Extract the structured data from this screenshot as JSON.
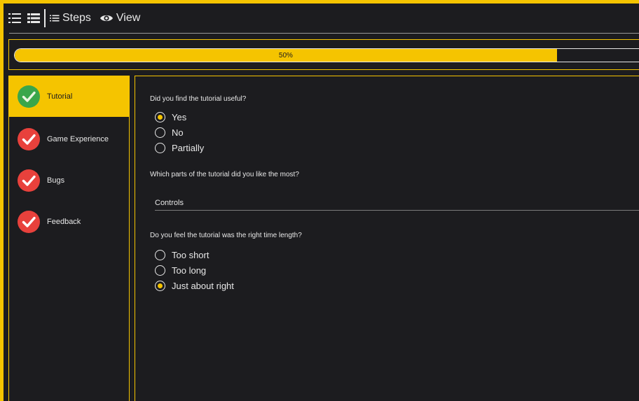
{
  "toolbar": {
    "steps_label": "Steps",
    "view_label": "View"
  },
  "progress": {
    "label": "50%",
    "value": 0.5
  },
  "sidebar": {
    "steps": [
      {
        "label": "Tutorial",
        "status": "complete",
        "active": true
      },
      {
        "label": "Game Experience",
        "status": "incomplete",
        "active": false
      },
      {
        "label": "Bugs",
        "status": "incomplete",
        "active": false
      },
      {
        "label": "Feedback",
        "status": "incomplete",
        "active": false
      }
    ]
  },
  "form": {
    "q1": {
      "text": "Did you find the tutorial useful?",
      "options": [
        "Yes",
        "No",
        "Partially"
      ],
      "selected": "Yes"
    },
    "q2": {
      "text": "Which parts of the tutorial did you like the most?",
      "value": "Controls"
    },
    "q3": {
      "text": "Do you feel the tutorial was the right time length?",
      "options": [
        "Too short",
        "Too long",
        "Just about right"
      ],
      "selected": "Just about right"
    }
  },
  "colors": {
    "accent": "#f5c400",
    "background": "#1c1c1f",
    "complete": "#3aa64a",
    "incomplete": "#e8413c"
  }
}
